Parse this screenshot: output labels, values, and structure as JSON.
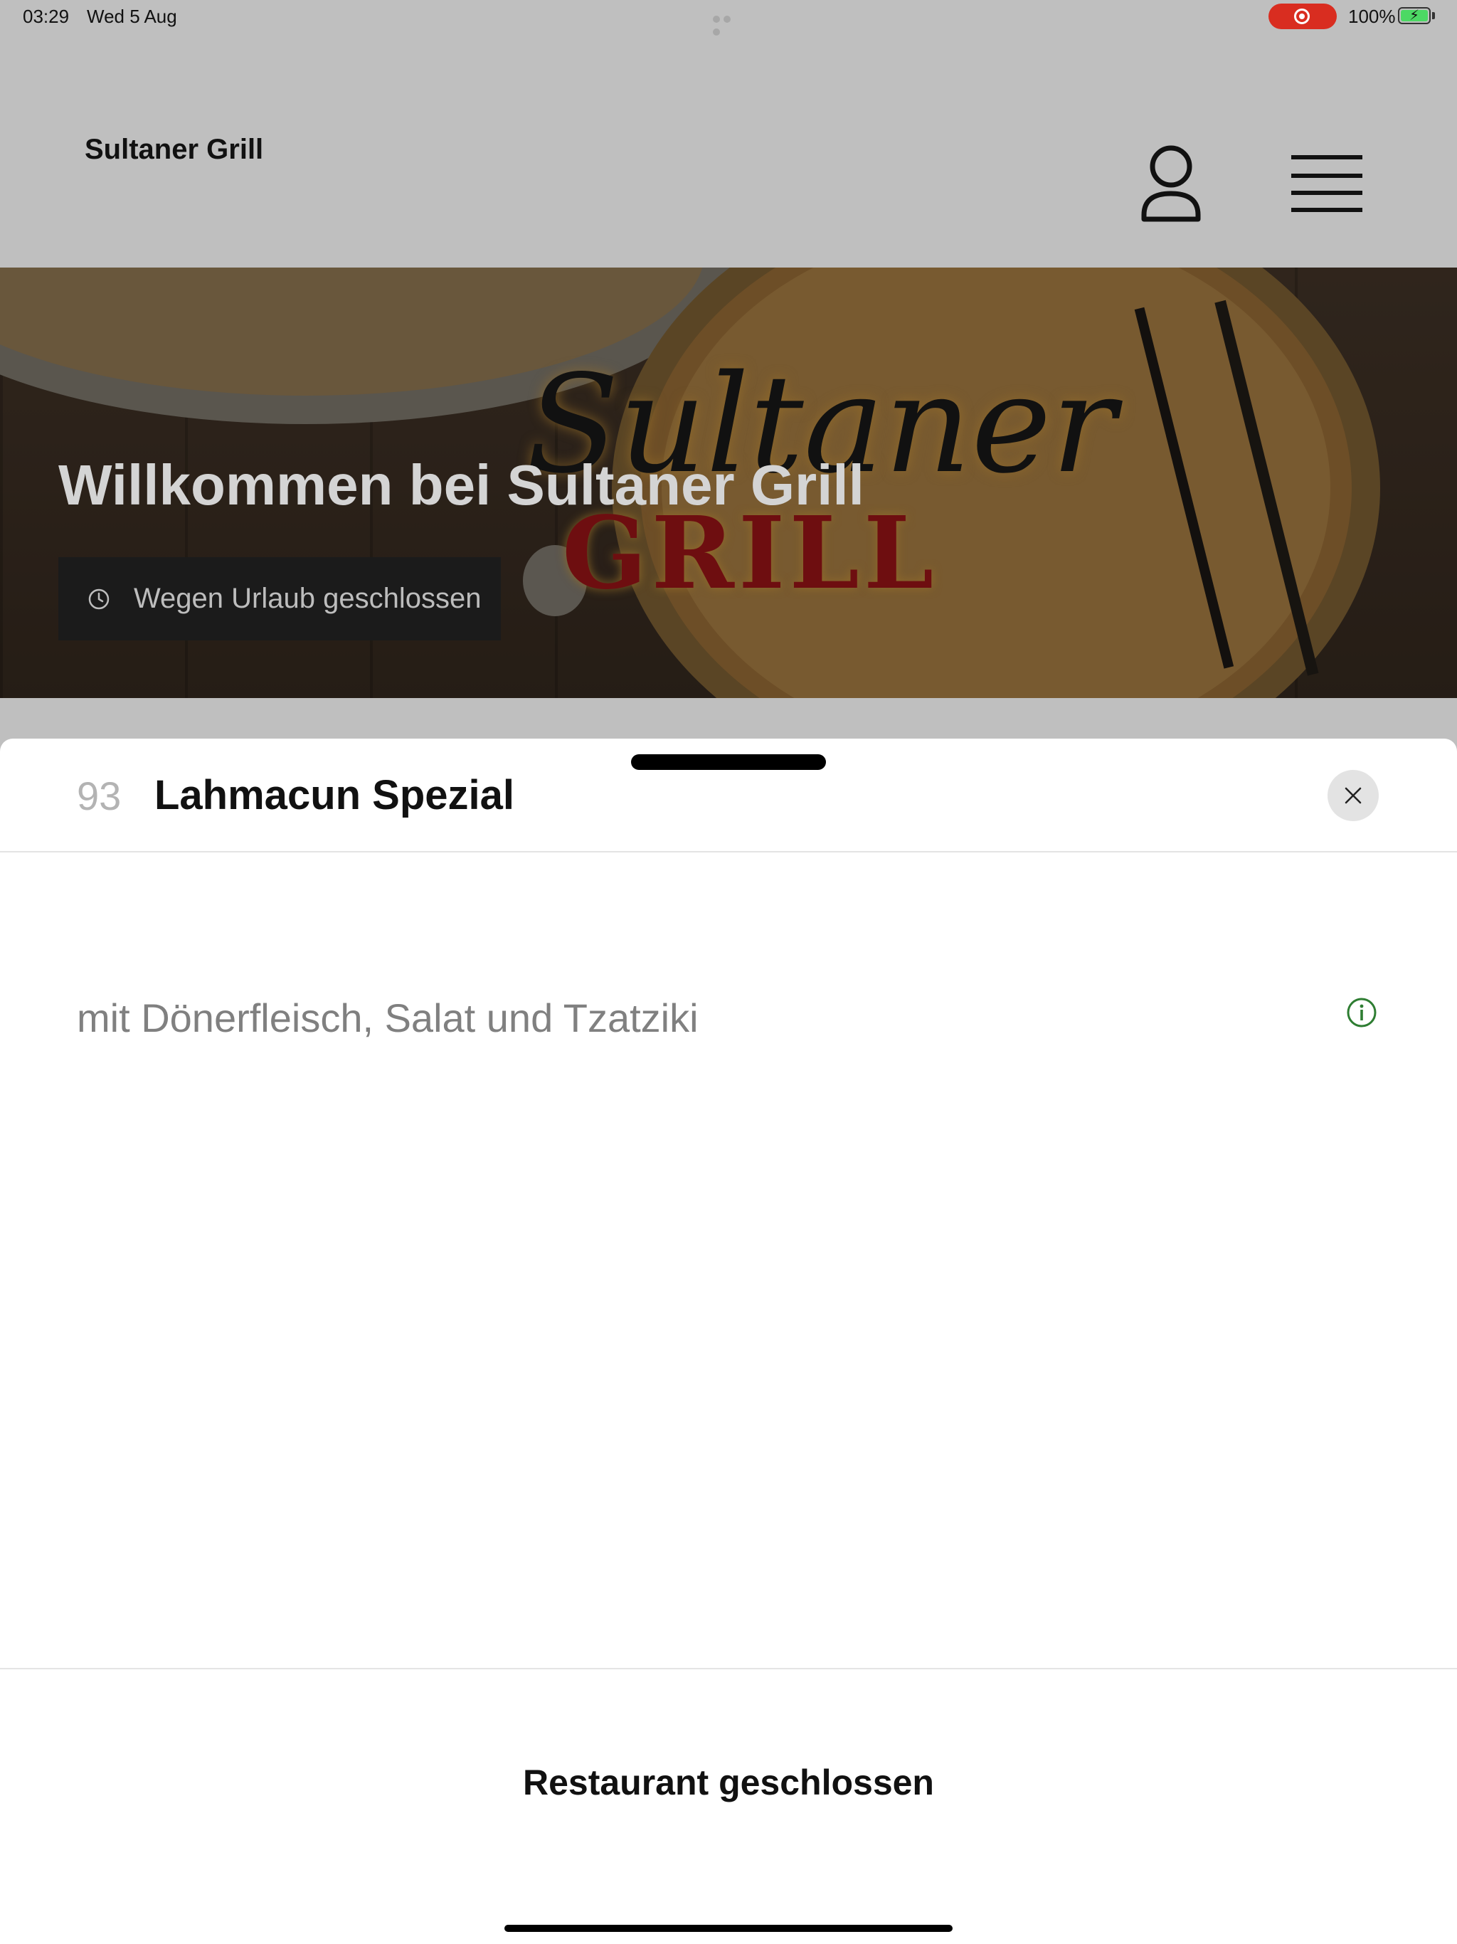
{
  "status_bar": {
    "time": "03:29",
    "date": "Wed 5 Aug",
    "battery": "100%",
    "recording_color": "#d92d20",
    "battery_color": "#4cd964"
  },
  "header": {
    "brand": "Sultaner Grill",
    "account_icon": "person-icon",
    "menu_icon": "hamburger-menu-icon"
  },
  "hero": {
    "logo_script": "Sultaner",
    "logo_grill": "GRILL",
    "title": "Willkommen bei Sultaner Grill",
    "status_text": "Wegen Urlaub geschlossen",
    "status_icon": "clock-icon"
  },
  "item_sheet": {
    "number": "93",
    "title": "Lahmacun Spezial",
    "description": "mit Dönerfleisch, Salat und Tzatziki",
    "close_icon": "close-icon",
    "info_icon": "info-icon",
    "info_color": "#2e7d32",
    "footer_label": "Restaurant geschlossen"
  }
}
